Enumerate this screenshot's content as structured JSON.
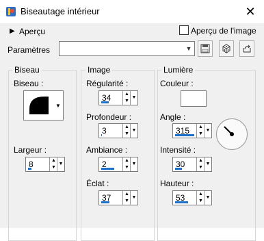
{
  "window": {
    "title": "Biseautage intérieur",
    "close_glyph": "✕"
  },
  "apercu": {
    "label": "Aperçu",
    "checkbox_label": "Aperçu de l'image",
    "checked": false
  },
  "parametres": {
    "label": "Paramètres",
    "value": ""
  },
  "groups": {
    "biseau": {
      "title": "Biseau",
      "biseau_label": "Biseau :",
      "largeur_label": "Largeur :",
      "largeur_value": "8",
      "largeur_fill": 0.15
    },
    "image": {
      "title": "Image",
      "regularite_label": "Régularité :",
      "regularite_value": "34",
      "regularite_fill": 0.34,
      "profondeur_label": "Profondeur :",
      "profondeur_value": "3",
      "profondeur_fill": 0.03,
      "ambiance_label": "Ambiance :",
      "ambiance_value": "2",
      "ambiance_fill": 0.6,
      "eclat_label": "Éclat :",
      "eclat_value": "37",
      "eclat_fill": 0.37
    },
    "lumiere": {
      "title": "Lumière",
      "couleur_label": "Couleur :",
      "couleur_value": "#ffffff",
      "angle_label": "Angle :",
      "angle_value": "315",
      "angle_fill": 0.875,
      "intensite_label": "Intensité :",
      "intensite_value": "30",
      "intensite_fill": 0.3,
      "hauteur_label": "Hauteur :",
      "hauteur_value": "53",
      "hauteur_fill": 0.59
    }
  },
  "colors": {
    "accent": "#1c6fc8",
    "panel_bg": "#f0f0f0"
  }
}
